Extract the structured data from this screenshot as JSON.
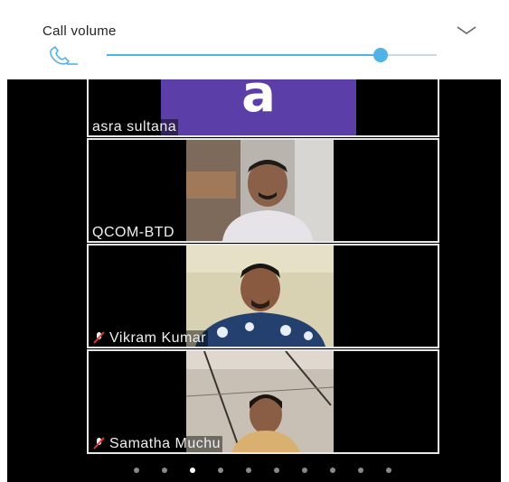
{
  "volume": {
    "title": "Call volume",
    "level": 0.83,
    "accent_color": "#4fb3e6",
    "icons": {
      "phone": "phone-icon",
      "collapse": "chevron-down-icon"
    }
  },
  "participants": [
    {
      "name": "asra sultana",
      "avatar_letter": "a",
      "avatar_color": "#5b3ea8",
      "muted": false
    },
    {
      "name": "QCOM-BTD",
      "muted": false
    },
    {
      "name": "Vikram Kumar",
      "muted": true
    },
    {
      "name": "Samatha Muchu",
      "muted": true
    }
  ],
  "pager": {
    "count": 10,
    "active_index": 2
  }
}
